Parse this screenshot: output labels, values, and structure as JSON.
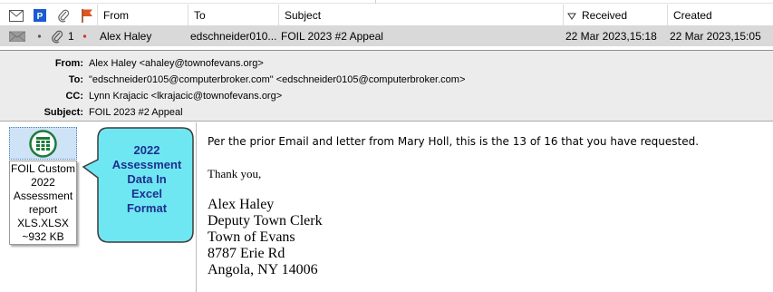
{
  "columns": {
    "from": "From",
    "to": "To",
    "subject": "Subject",
    "received": "Received",
    "created": "Created"
  },
  "message": {
    "thread_count": "1",
    "from": "Alex Haley",
    "to": "edschneider010...",
    "subject": "FOIL 2023 #2 Appeal",
    "received": "22 Mar 2023,15:18",
    "created": "22 Mar 2023,15:05"
  },
  "headers": {
    "from_label": "From:",
    "from_value": "Alex Haley <ahaley@townofevans.org>",
    "to_label": "To:",
    "to_value": "\"edschneider0105@computerbroker.com\" <edschneider0105@computerbroker.com>",
    "cc_label": "CC:",
    "cc_value": "Lynn Krajacic <lkrajacic@townofevans.org>",
    "subject_label": "Subject:",
    "subject_value": "FOIL 2023 #2 Appeal"
  },
  "attachment": {
    "lines": [
      "FOIL Custom",
      "2022",
      "Assessment",
      "report",
      "XLS.XLSX",
      "~932 KB"
    ],
    "icon": "excel-attachment-icon"
  },
  "callout": {
    "lines": [
      "2022",
      "Assessment",
      "Data In",
      "Excel",
      "Format"
    ]
  },
  "body": {
    "line1": "Per the prior Email and letter from Mary Holl, this is the 13 of 16 that you have requested.",
    "line2": "Thank you,",
    "signature": [
      "Alex Haley",
      "Deputy Town Clerk",
      "Town of Evans",
      "8787 Erie Rd",
      "Angola, NY 14006"
    ]
  },
  "colors": {
    "callout_fill": "#6fe7f2",
    "callout_text": "#1d2f8f",
    "flag": "#e0541f",
    "priority": "#1a5bd0"
  }
}
